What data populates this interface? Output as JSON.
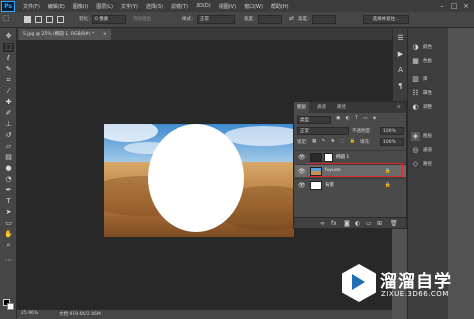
{
  "app": {
    "logo": "Ps",
    "menu": [
      "文件(F)",
      "编辑(E)",
      "图像(I)",
      "图层(L)",
      "文字(Y)",
      "选择(S)",
      "滤镜(T)",
      "3D(D)",
      "视图(V)",
      "窗口(W)",
      "帮助(H)"
    ],
    "window_controls": [
      "–",
      "□",
      "×"
    ]
  },
  "options_bar": {
    "feather_label": "羽化：",
    "feather_value": "0 像素",
    "antialias_label": "消除锯齿",
    "style_label": "样式：",
    "style_value": "正常",
    "width_label": "宽度：",
    "height_label": "高度：",
    "select_mask_label": "选择并遮住..."
  },
  "document": {
    "tab_title": "5.jpg @ 25% (椭圆 1, RGB/8#) *",
    "close_icon": "×"
  },
  "status_bar": {
    "zoom": "25.96%",
    "doc_info": "文档:919.6K/2.46M"
  },
  "layers_panel": {
    "tabs": [
      "图层",
      "通道",
      "路径"
    ],
    "kind_filter": "类型",
    "blend_mode": "正常",
    "opacity_label": "不透明度:",
    "opacity_value": "100%",
    "lock_label": "锁定:",
    "fill_label": "填充:",
    "fill_value": "100%",
    "layers": [
      {
        "name": "椭圆 1",
        "visible": true,
        "selected": false,
        "locked": false
      },
      {
        "name": "fuyuan",
        "visible": true,
        "selected": true,
        "locked": true
      },
      {
        "name": "背景",
        "visible": true,
        "selected": false,
        "locked": true
      }
    ]
  },
  "right_dock": {
    "items": [
      {
        "label": "颜色",
        "icon": "color-icon"
      },
      {
        "label": "色板",
        "icon": "swatches-icon"
      },
      {
        "label": "库",
        "icon": "library-icon"
      },
      {
        "label": "属性",
        "icon": "properties-icon"
      },
      {
        "label": "调整",
        "icon": "adjustments-icon"
      },
      {
        "label": "图层",
        "icon": "layers-icon",
        "active": true
      },
      {
        "label": "通道",
        "icon": "channels-icon"
      },
      {
        "label": "路径",
        "icon": "paths-icon"
      }
    ]
  },
  "watermark": {
    "title": "溜溜自学",
    "subtitle": "ZIXUE.3D66.COM"
  },
  "colors": {
    "highlight_red": "#e0262b",
    "ps_blue": "#31a8ff"
  }
}
